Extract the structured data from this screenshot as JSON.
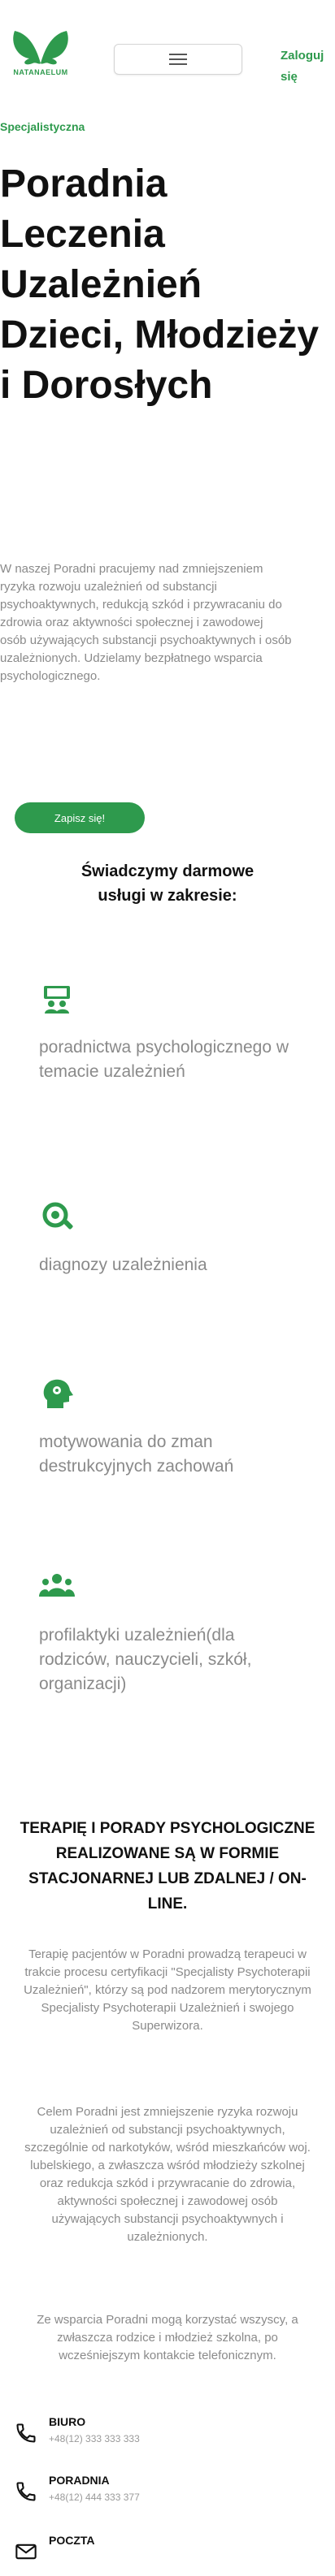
{
  "header": {
    "logo_text": "NATANAELUM",
    "login_label": "Zaloguj się"
  },
  "hero": {
    "kicker": "Specjalistyczna",
    "title": "Poradnia Leczenia Uzależnień Dzieci, Młodzieży i Dorosłych",
    "description": "W naszej Poradni pracujemy nad zmniejszeniem ryzyka rozwoju uzależnień od substancji psychoaktywnych, redukcją szkód i przywracaniu do zdrowia oraz aktywności społecznej i zawodowej osób używających substancji psychoaktywnych i osób uzależnionych. Udzielamy bezpłatnego wsparcia psychologicznego.",
    "cta_label": "Zapisz się!"
  },
  "services": {
    "title": "Świadczymy darmowe usługi w zakresie:",
    "items": [
      {
        "icon": "counseling-icon",
        "label": "poradnictwa psychologicznego w temacie uzależnień"
      },
      {
        "icon": "diagnosis-icon",
        "label": "diagnozy uzależnienia"
      },
      {
        "icon": "motivation-icon",
        "label": "motywowania do zman destrukcyjnych zachowań"
      },
      {
        "icon": "group-icon",
        "label": "profilaktyki uzależnień(dla rodziców, nauczycieli, szkół, organizacji)"
      }
    ]
  },
  "therapy": {
    "title": "TERAPIĘ I PORADY PSYCHOLOGICZNE REALIZOWANE SĄ W FORMIE STACJONARNEJ LUB ZDALNEJ / ON-LINE.",
    "paragraphs": [
      "Terapię pacjentów w Poradni prowadzą terapeuci w trakcie procesu certyfikacji \"Specjalisty Psychoterapii Uzależnień\", którzy są pod nadzorem merytorycznym Specjalisty Psychoterapii Uzależnień i swojego Superwizora.",
      "Celem Poradni jest zmniejszenie ryzyka rozwoju uzależnień od substancji psychoaktywnych, szczególnie od narkotyków, wśród mieszkańców woj. lubelskiego, a zwłaszcza wśród młodzieży szkolnej oraz redukcja szkód i przywracanie do zdrowia, aktywności społecznej i zawodowej osób używających substancji psychoaktywnych i uzależnionych.",
      "Ze wsparcia Poradni mogą korzystać wszyscy, a zwłaszcza rodzice i młodzież szkolna, po wcześniejszym kontakcie telefonicznym."
    ]
  },
  "contacts": [
    {
      "icon": "phone-icon",
      "label": "BIURO",
      "value": "+48(12) 333 333 333"
    },
    {
      "icon": "phone-icon",
      "label": "PORADNIA",
      "value": "+48(12) 444 333 377"
    },
    {
      "icon": "mail-icon",
      "label": "POCZTA",
      "value": ""
    }
  ],
  "colors": {
    "accent": "#2e9a4d",
    "muted_text": "#8a8a8a",
    "heading": "#111111"
  }
}
